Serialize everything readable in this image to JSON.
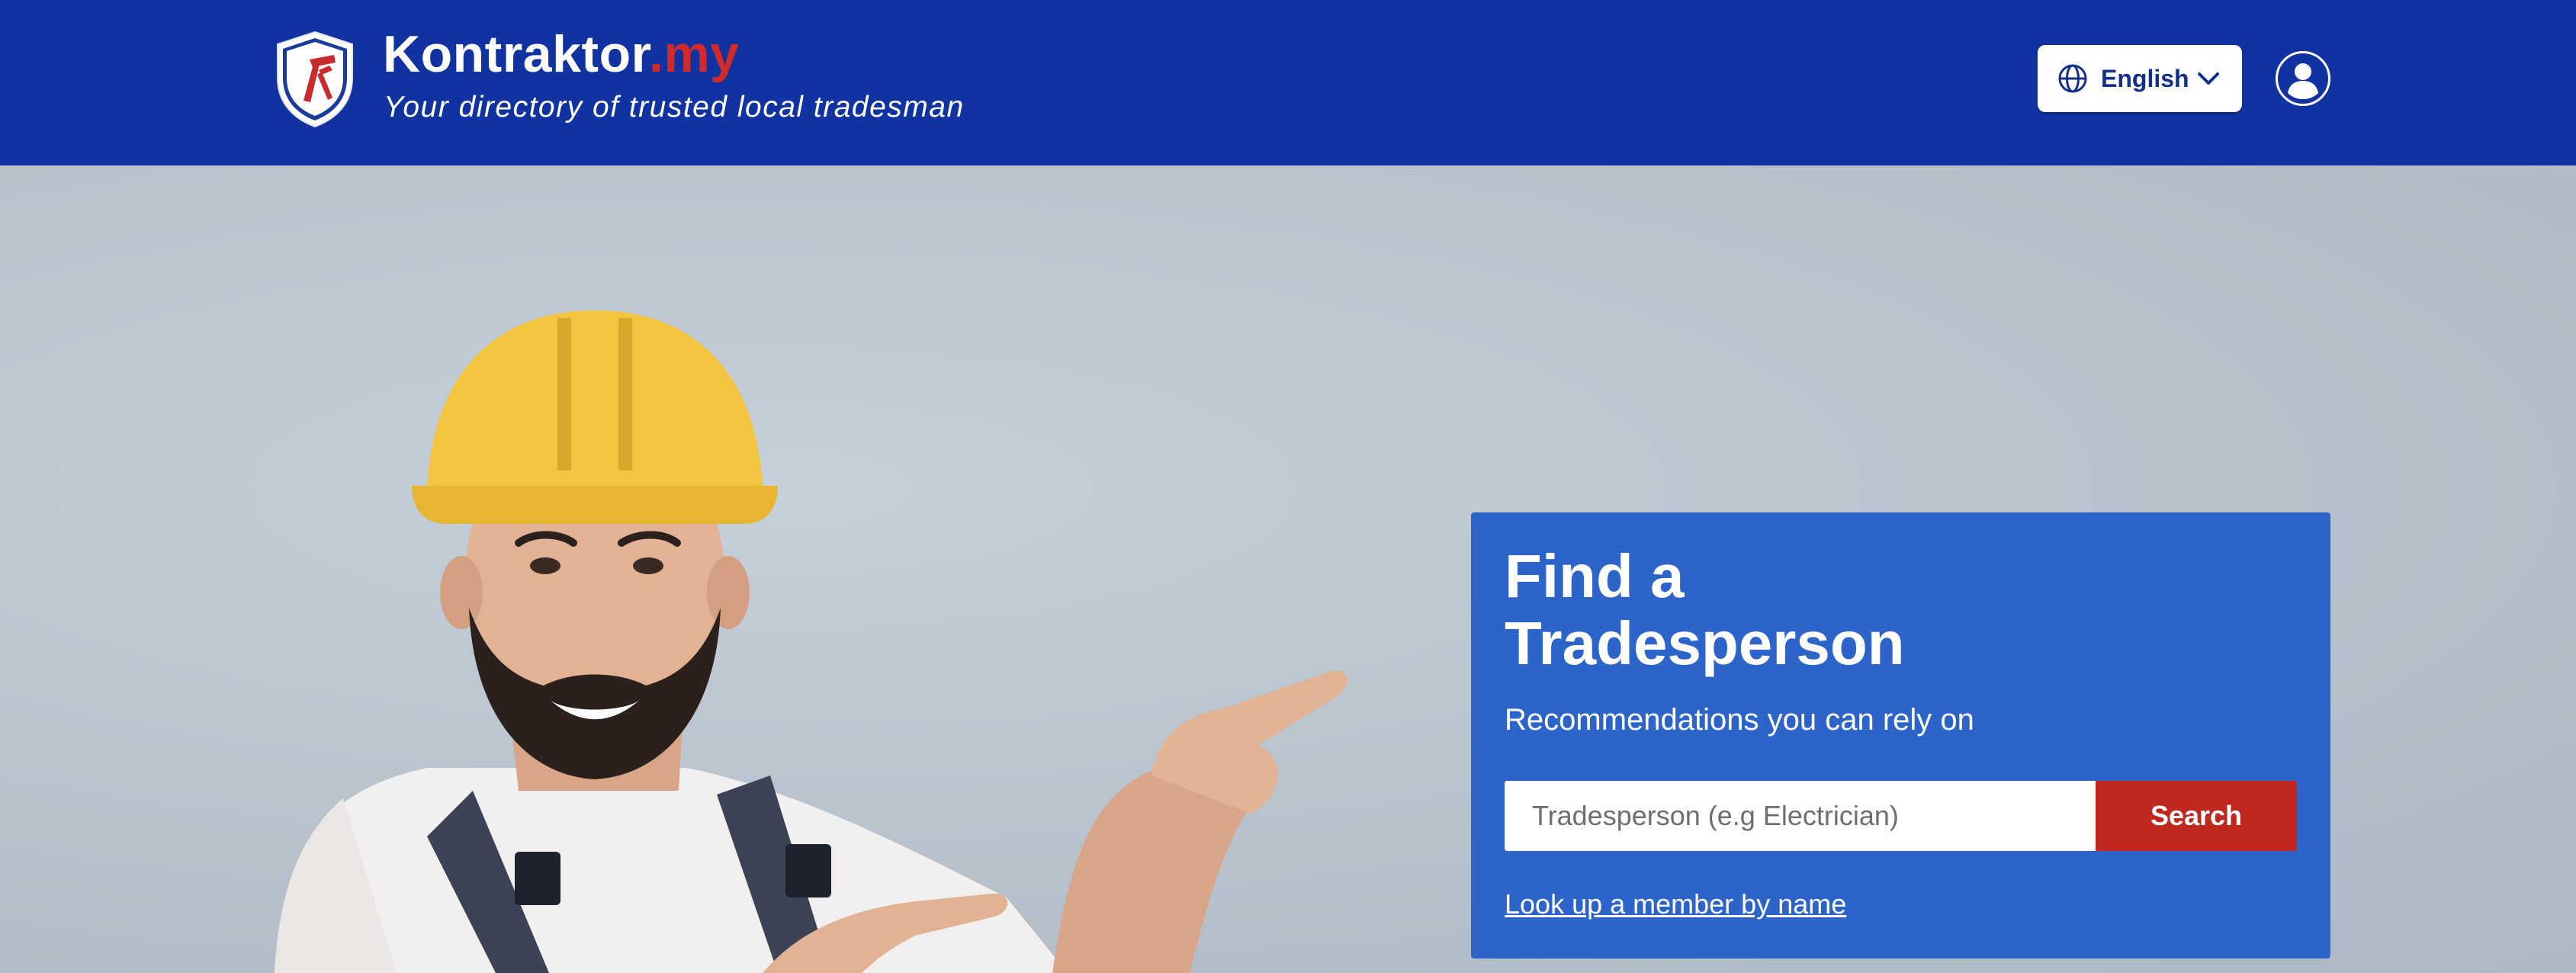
{
  "header": {
    "brand_name": "Kontraktor",
    "brand_tld": ".my",
    "tagline": "Your directory of trusted local tradesman",
    "language_label": "English",
    "icons": {
      "logo": "shield-hammer-logo",
      "language": "globe-icon",
      "dropdown": "chevron-down-icon",
      "account": "user-avatar-icon"
    }
  },
  "hero": {
    "image_subject": "worker-in-hard-hat-pointing",
    "card": {
      "title_line1": "Find a",
      "title_line2": "Tradesperson",
      "subtitle": "Recommendations you can rely on",
      "search_placeholder": "Tradesperson (e.g Electrician)",
      "search_value": "",
      "search_button": "Search",
      "lookup_link": "Look up a member by name"
    }
  },
  "colors": {
    "header_bg": "#1033a1",
    "card_bg": "#2c64c9",
    "accent_red": "#c0281f",
    "tld_red": "#d22a2a"
  }
}
